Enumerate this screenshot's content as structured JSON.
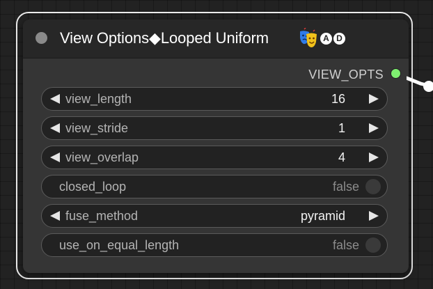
{
  "node": {
    "title": "View Options◆Looped Uniform",
    "icons": [
      "theater-masks-icon",
      "a-badge-icon",
      "d-badge-icon"
    ],
    "badges": [
      "A",
      "D"
    ],
    "output": {
      "label": "VIEW_OPTS",
      "color": "#7ef070"
    }
  },
  "widgets": [
    {
      "name": "view_length",
      "value": "16",
      "type": "number"
    },
    {
      "name": "view_stride",
      "value": "1",
      "type": "number"
    },
    {
      "name": "view_overlap",
      "value": "4",
      "type": "number"
    },
    {
      "name": "closed_loop",
      "value": "false",
      "type": "toggle"
    },
    {
      "name": "fuse_method",
      "value": "pyramid",
      "type": "combo"
    },
    {
      "name": "use_on_equal_length",
      "value": "false",
      "type": "toggle"
    }
  ]
}
